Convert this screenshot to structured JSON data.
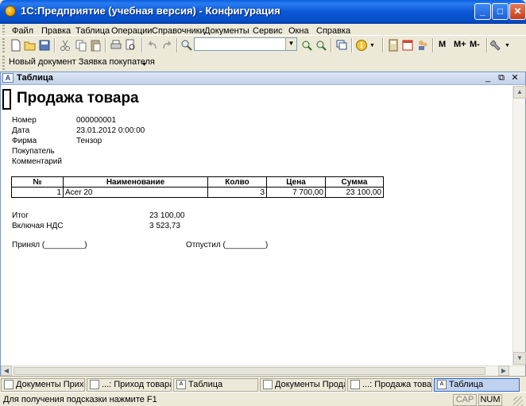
{
  "window": {
    "title": "1С:Предприятие (учебная версия) - Конфигурация"
  },
  "menu": [
    "Файл",
    "Правка",
    "Таблица",
    "Операции",
    "Справочники",
    "Документы",
    "Сервис",
    "Окна",
    "Справка"
  ],
  "toolbar": {
    "memory_buttons": [
      "M",
      "M+",
      "M-"
    ]
  },
  "toolbar2": {
    "new_doc_label": "Новый документ Заявка покупателя"
  },
  "child": {
    "title": "Таблица"
  },
  "doc": {
    "title": "Продажа товара",
    "fields": [
      {
        "label": "Номер",
        "value": "000000001"
      },
      {
        "label": "Дата",
        "value": "23.01.2012 0:00:00"
      },
      {
        "label": "Фирма",
        "value": "Тензор"
      },
      {
        "label": "Покупатель",
        "value": ""
      },
      {
        "label": "Комментарий",
        "value": ""
      }
    ],
    "table": {
      "headers": [
        "№",
        "Наименование",
        "Колво",
        "Цена",
        "Сумма"
      ],
      "rows": [
        [
          "1",
          "Acer 20",
          "3",
          "7 700,00",
          "23 100,00"
        ]
      ]
    },
    "total_label": "Итог",
    "total_value": "23 100,00",
    "vat_label": "Включая НДС",
    "vat_value": "3 523,73",
    "accepted": "Принял (_________)",
    "released": "Отпустил (_________)"
  },
  "window_tabs": [
    {
      "label": "Документы Прихо...",
      "active": false
    },
    {
      "label": "...: Приход товара ...",
      "active": false
    },
    {
      "label": "Таблица",
      "active": false
    },
    {
      "label": "Документы Прода...",
      "active": false
    },
    {
      "label": "...: Продажа товар...",
      "active": false
    },
    {
      "label": "Таблица",
      "active": true
    }
  ],
  "status": {
    "hint": "Для получения подсказки нажмите F1",
    "caps": "CAP",
    "num": "NUM"
  }
}
